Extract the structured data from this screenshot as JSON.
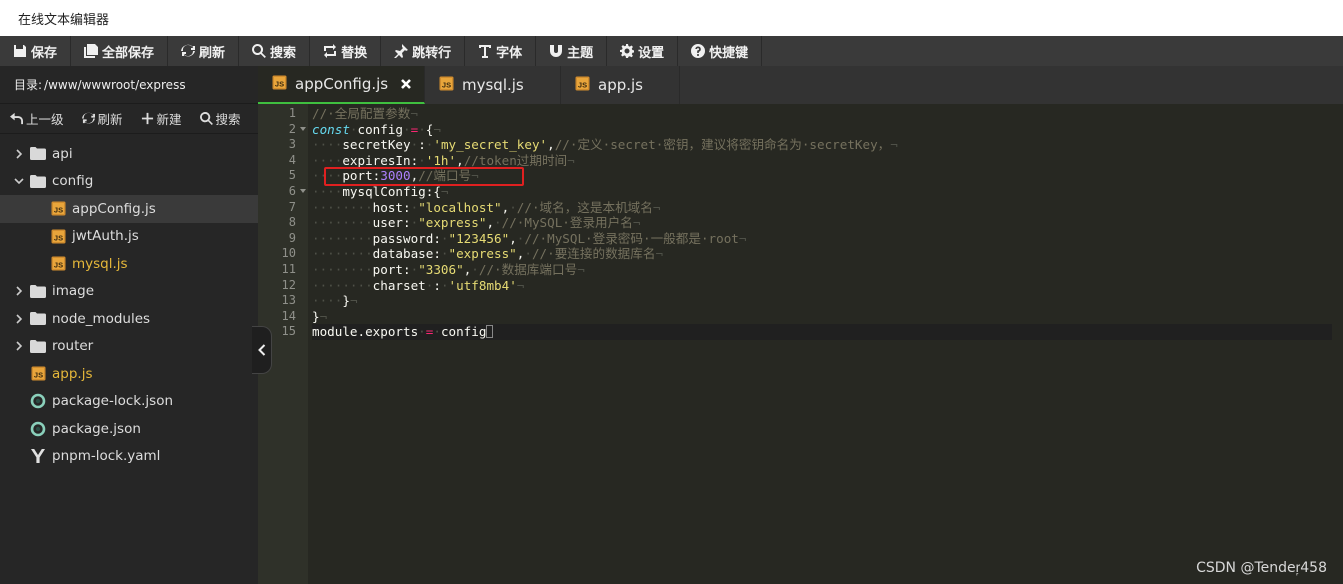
{
  "window": {
    "title": "在线文本编辑器"
  },
  "toolbar": {
    "buttons": [
      {
        "icon": "save-icon",
        "label": "保存"
      },
      {
        "icon": "save-all-icon",
        "label": "全部保存"
      },
      {
        "icon": "refresh-icon",
        "label": "刷新"
      },
      {
        "icon": "search-icon",
        "label": "搜索"
      },
      {
        "icon": "replace-icon",
        "label": "替换"
      },
      {
        "icon": "goto-icon",
        "label": "跳转行"
      },
      {
        "icon": "font-icon",
        "label": "字体"
      },
      {
        "icon": "theme-icon",
        "label": "主题"
      },
      {
        "icon": "gear-icon",
        "label": "设置"
      },
      {
        "icon": "question-icon",
        "label": "快捷键"
      }
    ]
  },
  "sidebar": {
    "path_label": "目录:",
    "path_value": "/www/wwwroot/express",
    "actions": [
      {
        "icon": "up-level-icon",
        "label": "上一级"
      },
      {
        "icon": "refresh-icon",
        "label": "刷新"
      },
      {
        "icon": "plus-icon",
        "label": "新建"
      },
      {
        "icon": "search-icon",
        "label": "搜索"
      }
    ],
    "tree": [
      {
        "name": "api",
        "type": "folder",
        "expanded": false,
        "depth": 0
      },
      {
        "name": "config",
        "type": "folder",
        "expanded": true,
        "depth": 0
      },
      {
        "name": "appConfig.js",
        "type": "js",
        "depth": 1,
        "selected": true
      },
      {
        "name": "jwtAuth.js",
        "type": "js",
        "depth": 1
      },
      {
        "name": "mysql.js",
        "type": "js",
        "depth": 1,
        "open": true
      },
      {
        "name": "image",
        "type": "folder",
        "expanded": false,
        "depth": 0
      },
      {
        "name": "node_modules",
        "type": "folder",
        "expanded": false,
        "depth": 0
      },
      {
        "name": "router",
        "type": "folder",
        "expanded": false,
        "depth": 0
      },
      {
        "name": "app.js",
        "type": "js",
        "depth": 0,
        "open": true
      },
      {
        "name": "package-lock.json",
        "type": "json",
        "depth": 0
      },
      {
        "name": "package.json",
        "type": "json",
        "depth": 0
      },
      {
        "name": "pnpm-lock.yaml",
        "type": "yaml",
        "depth": 0
      }
    ]
  },
  "tabs": [
    {
      "label": "appConfig.js",
      "active": true,
      "closable": true
    },
    {
      "label": "mysql.js",
      "active": false
    },
    {
      "label": "app.js",
      "active": false
    }
  ],
  "editor": {
    "lines": [
      [
        [
          "cm",
          "//·全局配置参数"
        ],
        [
          "ws",
          "¬"
        ]
      ],
      [
        [
          "kw",
          "const"
        ],
        [
          "ws",
          "·"
        ],
        [
          "",
          "config"
        ],
        [
          "ws",
          "·"
        ],
        [
          "op",
          "="
        ],
        [
          "ws",
          "·"
        ],
        [
          "",
          "{"
        ],
        [
          "ws",
          "¬"
        ]
      ],
      [
        [
          "ws",
          "····"
        ],
        [
          "",
          "secretKey"
        ],
        [
          "ws",
          "·"
        ],
        [
          "",
          ":"
        ],
        [
          "ws",
          "·"
        ],
        [
          "str",
          "'my_secret_key'"
        ],
        [
          "",
          ","
        ],
        [
          "cm",
          "//·定义·secret·密钥，建议将密钥命名为·secretKey，"
        ],
        [
          "ws",
          "¬"
        ]
      ],
      [
        [
          "ws",
          "····"
        ],
        [
          "",
          "expiresIn:"
        ],
        [
          "ws",
          "·"
        ],
        [
          "str",
          "'1h'"
        ],
        [
          "",
          ","
        ],
        [
          "cm",
          "//token过期时间"
        ],
        [
          "ws",
          "¬"
        ]
      ],
      [
        [
          "ws",
          "····"
        ],
        [
          "",
          "port:"
        ],
        [
          "num",
          "3000"
        ],
        [
          "",
          ","
        ],
        [
          "cm",
          "//端口号"
        ],
        [
          "ws",
          "¬"
        ]
      ],
      [
        [
          "ws",
          "····"
        ],
        [
          "",
          "mysqlConfig:{"
        ],
        [
          "ws",
          "¬"
        ]
      ],
      [
        [
          "ws",
          "········"
        ],
        [
          "",
          "host:"
        ],
        [
          "ws",
          "·"
        ],
        [
          "str",
          "\"localhost\""
        ],
        [
          "",
          ","
        ],
        [
          "ws",
          "·"
        ],
        [
          "cm",
          "//·域名，这是本机域名"
        ],
        [
          "ws",
          "¬"
        ]
      ],
      [
        [
          "ws",
          "········"
        ],
        [
          "",
          "user:"
        ],
        [
          "ws",
          "·"
        ],
        [
          "str",
          "\"express\""
        ],
        [
          "",
          ","
        ],
        [
          "ws",
          "·"
        ],
        [
          "cm",
          "//·MySQL·登录用户名"
        ],
        [
          "ws",
          "¬"
        ]
      ],
      [
        [
          "ws",
          "········"
        ],
        [
          "",
          "password:"
        ],
        [
          "ws",
          "·"
        ],
        [
          "str",
          "\"123456\""
        ],
        [
          "",
          ","
        ],
        [
          "ws",
          "·"
        ],
        [
          "cm",
          "//·MySQL·登录密码·一般都是·root"
        ],
        [
          "ws",
          "¬"
        ]
      ],
      [
        [
          "ws",
          "········"
        ],
        [
          "",
          "database:"
        ],
        [
          "ws",
          "·"
        ],
        [
          "str",
          "\"express\""
        ],
        [
          "",
          ","
        ],
        [
          "ws",
          "·"
        ],
        [
          "cm",
          "//·要连接的数据库名"
        ],
        [
          "ws",
          "¬"
        ]
      ],
      [
        [
          "ws",
          "········"
        ],
        [
          "",
          "port:"
        ],
        [
          "ws",
          "·"
        ],
        [
          "str",
          "\"3306\""
        ],
        [
          "",
          ","
        ],
        [
          "ws",
          "·"
        ],
        [
          "cm",
          "//·数据库端口号"
        ],
        [
          "ws",
          "¬"
        ]
      ],
      [
        [
          "ws",
          "········"
        ],
        [
          "",
          "charset"
        ],
        [
          "ws",
          "·"
        ],
        [
          "",
          ":"
        ],
        [
          "ws",
          "·"
        ],
        [
          "str",
          "'utf8mb4'"
        ],
        [
          "ws",
          "¬"
        ]
      ],
      [
        [
          "ws",
          "····"
        ],
        [
          "",
          "}"
        ],
        [
          "ws",
          "¬"
        ]
      ],
      [
        [
          "",
          "}"
        ],
        [
          "ws",
          "¬"
        ]
      ],
      [
        [
          "",
          "module.exports"
        ],
        [
          "ws",
          "·"
        ],
        [
          "op",
          "="
        ],
        [
          "ws",
          "·"
        ],
        [
          "",
          "config"
        ]
      ]
    ],
    "fold_lines": [
      2,
      6
    ],
    "current_line": 15
  },
  "watermark": "CSDN @Tender᷊458"
}
